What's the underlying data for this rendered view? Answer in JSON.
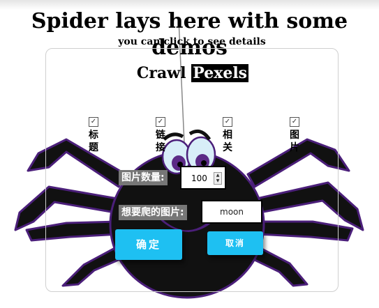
{
  "page": {
    "title": "Spider lays here with some demos",
    "subtitle": "you can click to see details"
  },
  "card": {
    "title_prefix": "Crawl",
    "title_highlight": "Pexels"
  },
  "options": [
    {
      "label": "标题",
      "checked": true
    },
    {
      "label": "链接",
      "checked": true
    },
    {
      "label": "相关",
      "checked": true
    },
    {
      "label": "图片",
      "checked": true
    }
  ],
  "form": {
    "count_label": "图片数量:",
    "count_value": "100",
    "keyword_label": "想要爬的图片:",
    "keyword_value": "moon"
  },
  "buttons": {
    "ok": "确定",
    "cancel": "取消"
  },
  "colors": {
    "button": "#1ec0f2",
    "spider": "#111111",
    "spider_outline": "#4b1f7a",
    "eye_iris": "#5b2a86"
  }
}
